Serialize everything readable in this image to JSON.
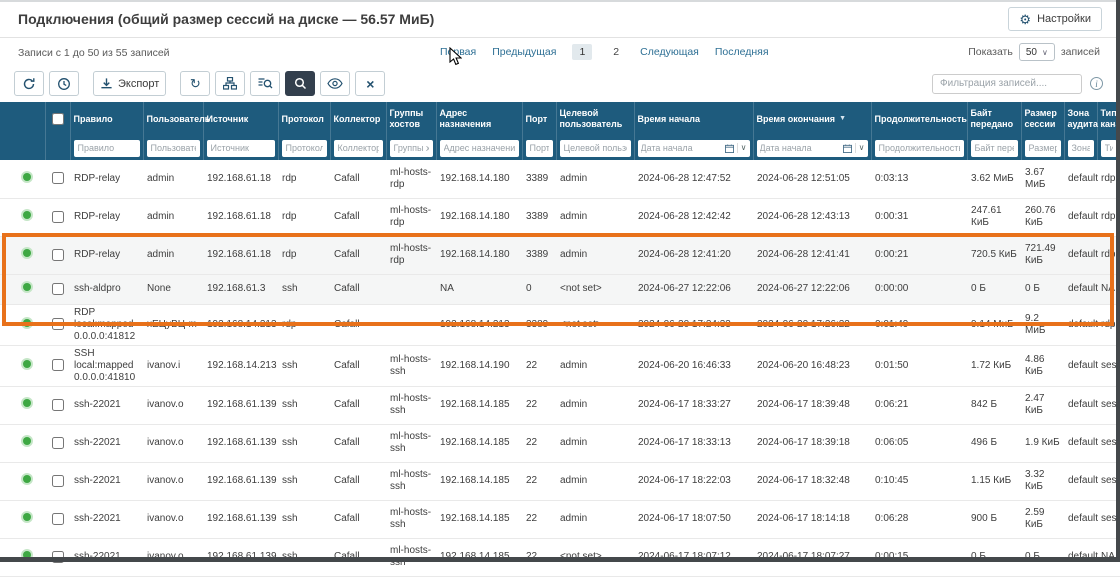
{
  "window": {
    "title": "Подключения (общий размер сессий на диске — 56.57 МиБ)",
    "settings_button": "Настройки"
  },
  "meta": {
    "records_summary": "Записи с 1 до 50 из 55 записей",
    "show_label": "Показать",
    "page_size": "50",
    "records_word": "записей",
    "filter_placeholder": "Фильтрация записей...."
  },
  "pagination": {
    "first": "Первая",
    "previous": "Предыдущая",
    "page1": "1",
    "page2": "2",
    "current_page": "1",
    "next": "Следующая",
    "last": "Последняя"
  },
  "toolbar": {
    "export_label": "Экспорт"
  },
  "icons": {
    "gear": "⚙",
    "refresh": "↻",
    "close": "×",
    "chevron_down": "∨",
    "sort_desc": "▼",
    "info": "i"
  },
  "colors": {
    "header_bg": "#1e5b7d",
    "accent": "#23516f",
    "highlight_border": "#e8711a",
    "status_green": "#3ea843"
  },
  "table": {
    "columns": [
      {
        "label": "Правило"
      },
      {
        "label": "Пользователь"
      },
      {
        "label": "Источник"
      },
      {
        "label": "Протокол"
      },
      {
        "label": "Коллектор"
      },
      {
        "label": "Группы хостов"
      },
      {
        "label": "Адрес назначения"
      },
      {
        "label": "Порт"
      },
      {
        "label": "Целевой пользователь"
      },
      {
        "label": "Время начала"
      },
      {
        "label": "Время окончания",
        "sorted": "desc"
      },
      {
        "label": "Продолжительность"
      },
      {
        "label": "Байт передано"
      },
      {
        "label": "Размер сессии"
      },
      {
        "label": "Зона аудита"
      },
      {
        "label": "Тип канала"
      }
    ],
    "filters": [
      {
        "type": "text",
        "placeholder": "Правило"
      },
      {
        "type": "text",
        "placeholder": "Пользователь"
      },
      {
        "type": "text",
        "placeholder": "Источник"
      },
      {
        "type": "text",
        "placeholder": "Протокол"
      },
      {
        "type": "text",
        "placeholder": "Коллектор"
      },
      {
        "type": "text",
        "placeholder": "Группы хостов"
      },
      {
        "type": "text",
        "placeholder": "Адрес назначения"
      },
      {
        "type": "text",
        "placeholder": "Порт"
      },
      {
        "type": "text",
        "placeholder": "Целевой пользователь"
      },
      {
        "type": "date",
        "placeholder": "Дата начала"
      },
      {
        "type": "date",
        "placeholder": "Дата начала"
      },
      {
        "type": "text",
        "placeholder": "Продолжительность"
      },
      {
        "type": "text",
        "placeholder": "Байт передано"
      },
      {
        "type": "text",
        "placeholder": "Размер сессии"
      },
      {
        "type": "text",
        "placeholder": "Зона аудита"
      },
      {
        "type": "text",
        "placeholder": "Тип канала"
      }
    ],
    "rows": [
      {
        "rule": "RDP-relay",
        "user": "admin",
        "source": "192.168.61.18",
        "protocol": "rdp",
        "collector": "Cafall",
        "host_groups": "ml-hosts-rdp",
        "dest": "192.168.14.180",
        "port": "3389",
        "target_user": "admin",
        "start": "2024-06-28 12:47:52",
        "end": "2024-06-28 12:51:05",
        "duration": "0:03:13",
        "bytes": "3.62 МиБ",
        "size": "3.67 МиБ",
        "zone": "default",
        "channel": "rdp"
      },
      {
        "rule": "RDP-relay",
        "user": "admin",
        "source": "192.168.61.18",
        "protocol": "rdp",
        "collector": "Cafall",
        "host_groups": "ml-hosts-rdp",
        "dest": "192.168.14.180",
        "port": "3389",
        "target_user": "admin",
        "start": "2024-06-28 12:42:42",
        "end": "2024-06-28 12:43:13",
        "duration": "0:00:31",
        "bytes": "247.61 КиБ",
        "size": "260.76 КиБ",
        "zone": "default",
        "channel": "rdp"
      },
      {
        "rule": "RDP-relay",
        "user": "admin",
        "source": "192.168.61.18",
        "protocol": "rdp",
        "collector": "Cafall",
        "host_groups": "ml-hosts-rdp",
        "dest": "192.168.14.180",
        "port": "3389",
        "target_user": "admin",
        "start": "2024-06-28 12:41:20",
        "end": "2024-06-28 12:41:41",
        "duration": "0:00:21",
        "bytes": "720.5 КиБ",
        "size": "721.49 КиБ",
        "zone": "default",
        "channel": "rdp",
        "shaded": true
      },
      {
        "rule": "ssh-aldpro",
        "user": "None",
        "source": "192.168.61.3",
        "protocol": "ssh",
        "collector": "Cafall",
        "host_groups": "",
        "dest": "NA",
        "port": "0",
        "target_user": "<not set>",
        "start": "2024-06-27 12:22:06",
        "end": "2024-06-27 12:22:06",
        "duration": "0:00:00",
        "bytes": "0 Б",
        "size": "0 Б",
        "zone": "default",
        "channel": "NA",
        "shaded": true
      },
      {
        "rule": "RDP local:mapped 0.0.0.0:41812",
        "user": "хЕЦуВЦ-m",
        "source": "192.168.14.213",
        "protocol": "rdp",
        "collector": "Cafall",
        "host_groups": "",
        "dest": "192.168.14.213",
        "port": "3389",
        "target_user": "<not set>",
        "start": "2024-06-20 17:24:33",
        "end": "2024-06-20 17:26:22",
        "duration": "0:01:49",
        "bytes": "9.14 МиБ",
        "size": "9.2 МиБ",
        "zone": "default",
        "channel": "rdp"
      },
      {
        "rule": "SSH local:mapped 0.0.0.0:41810",
        "user": "ivanov.i",
        "source": "192.168.14.213",
        "protocol": "ssh",
        "collector": "Cafall",
        "host_groups": "ml-hosts-ssh",
        "dest": "192.168.14.190",
        "port": "22",
        "target_user": "admin",
        "start": "2024-06-20 16:46:33",
        "end": "2024-06-20 16:48:23",
        "duration": "0:01:50",
        "bytes": "1.72 КиБ",
        "size": "4.86 КиБ",
        "zone": "default",
        "channel": "session"
      },
      {
        "rule": "ssh-22021",
        "user": "ivanov.o",
        "source": "192.168.61.139",
        "protocol": "ssh",
        "collector": "Cafall",
        "host_groups": "ml-hosts-ssh",
        "dest": "192.168.14.185",
        "port": "22",
        "target_user": "admin",
        "start": "2024-06-17 18:33:27",
        "end": "2024-06-17 18:39:48",
        "duration": "0:06:21",
        "bytes": "842 Б",
        "size": "2.47 КиБ",
        "zone": "default",
        "channel": "session"
      },
      {
        "rule": "ssh-22021",
        "user": "ivanov.o",
        "source": "192.168.61.139",
        "protocol": "ssh",
        "collector": "Cafall",
        "host_groups": "ml-hosts-ssh",
        "dest": "192.168.14.185",
        "port": "22",
        "target_user": "admin",
        "start": "2024-06-17 18:33:13",
        "end": "2024-06-17 18:39:18",
        "duration": "0:06:05",
        "bytes": "496 Б",
        "size": "1.9 КиБ",
        "zone": "default",
        "channel": "session"
      },
      {
        "rule": "ssh-22021",
        "user": "ivanov.o",
        "source": "192.168.61.139",
        "protocol": "ssh",
        "collector": "Cafall",
        "host_groups": "ml-hosts-ssh",
        "dest": "192.168.14.185",
        "port": "22",
        "target_user": "admin",
        "start": "2024-06-17 18:22:03",
        "end": "2024-06-17 18:32:48",
        "duration": "0:10:45",
        "bytes": "1.15 КиБ",
        "size": "3.32 КиБ",
        "zone": "default",
        "channel": "session"
      },
      {
        "rule": "ssh-22021",
        "user": "ivanov.o",
        "source": "192.168.61.139",
        "protocol": "ssh",
        "collector": "Cafall",
        "host_groups": "ml-hosts-ssh",
        "dest": "192.168.14.185",
        "port": "22",
        "target_user": "admin",
        "start": "2024-06-17 18:07:50",
        "end": "2024-06-17 18:14:18",
        "duration": "0:06:28",
        "bytes": "900 Б",
        "size": "2.59 КиБ",
        "zone": "default",
        "channel": "session"
      },
      {
        "rule": "ssh-22021",
        "user": "ivanov.o",
        "source": "192.168.61.139",
        "protocol": "ssh",
        "collector": "Cafall",
        "host_groups": "ml-hosts-ssh",
        "dest": "192.168.14.185",
        "port": "22",
        "target_user": "<not set>",
        "start": "2024-06-17 18:07:12",
        "end": "2024-06-17 18:07:27",
        "duration": "0:00:15",
        "bytes": "0 Б",
        "size": "0 Б",
        "zone": "default",
        "channel": "NA"
      }
    ]
  }
}
